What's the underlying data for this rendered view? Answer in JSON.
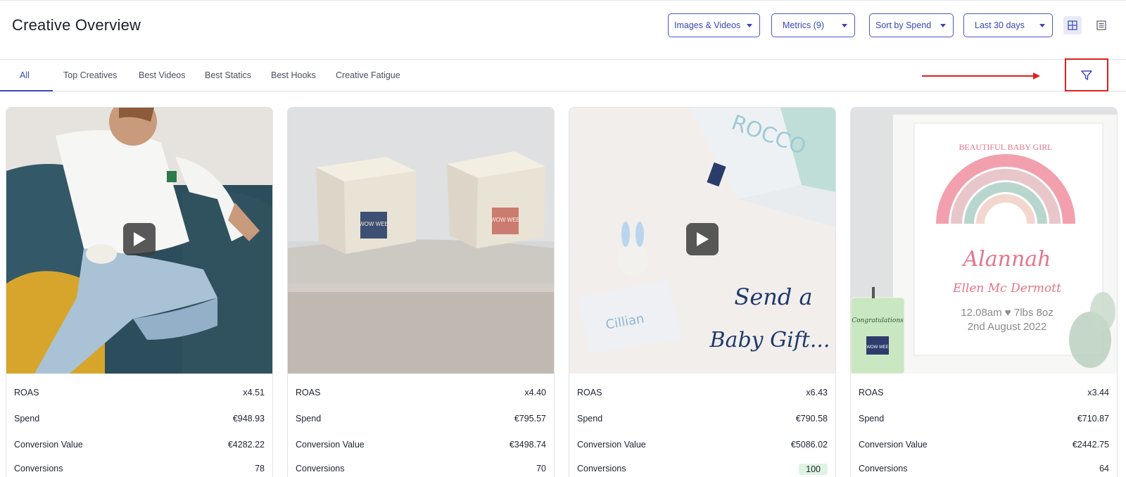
{
  "page": {
    "title": "Creative Overview"
  },
  "toolbar": {
    "media_filter": "Images & Videos",
    "metrics": "Metrics (9)",
    "sort": "Sort by Spend",
    "date_range": "Last 30 days",
    "grid_view_icon": "grid-icon",
    "list_view_icon": "list-icon"
  },
  "tabs": [
    {
      "label": "All",
      "active": true
    },
    {
      "label": "Top Creatives",
      "active": false
    },
    {
      "label": "Best Videos",
      "active": false
    },
    {
      "label": "Best Statics",
      "active": false
    },
    {
      "label": "Best Hooks",
      "active": false
    },
    {
      "label": "Creative Fatigue",
      "active": false
    }
  ],
  "filter": {
    "icon": "filter-icon",
    "highlight_color": "#e0201b"
  },
  "colors": {
    "accent": "#3a46b8",
    "annotation": "#e0201b",
    "positive_badge": "#dff3e3"
  },
  "creatives": [
    {
      "type": "video",
      "media_text": [],
      "metrics": [
        {
          "label": "ROAS",
          "value": "x4.51"
        },
        {
          "label": "Spend",
          "value": "€948.93"
        },
        {
          "label": "Conversion Value",
          "value": "€4282.22"
        },
        {
          "label": "Conversions",
          "value": "78"
        }
      ]
    },
    {
      "type": "image",
      "media_text": [
        "WOW WEE",
        "WOW WEE"
      ],
      "metrics": [
        {
          "label": "ROAS",
          "value": "x4.40"
        },
        {
          "label": "Spend",
          "value": "€795.57"
        },
        {
          "label": "Conversion Value",
          "value": "€3498.74"
        },
        {
          "label": "Conversions",
          "value": "70"
        }
      ]
    },
    {
      "type": "video",
      "media_text": [
        "ROCCO",
        "Cillian",
        "Send a",
        "Baby Gift..."
      ],
      "metrics": [
        {
          "label": "ROAS",
          "value": "x6.43"
        },
        {
          "label": "Spend",
          "value": "€790.58"
        },
        {
          "label": "Conversion Value",
          "value": "€5086.02"
        },
        {
          "label": "Conversions",
          "value": "100"
        }
      ]
    },
    {
      "type": "image",
      "media_text": [
        "BEAUTIFUL BABY GIRL",
        "Alannah",
        "Ellen Mc Dermott",
        "12.08am ♥ 7lbs 8oz",
        "2nd August 2022",
        "Congratulations",
        "WOW WEE"
      ],
      "metrics": [
        {
          "label": "ROAS",
          "value": "x3.44"
        },
        {
          "label": "Spend",
          "value": "€710.87"
        },
        {
          "label": "Conversion Value",
          "value": "€2442.75"
        },
        {
          "label": "Conversions",
          "value": "64"
        }
      ]
    }
  ]
}
